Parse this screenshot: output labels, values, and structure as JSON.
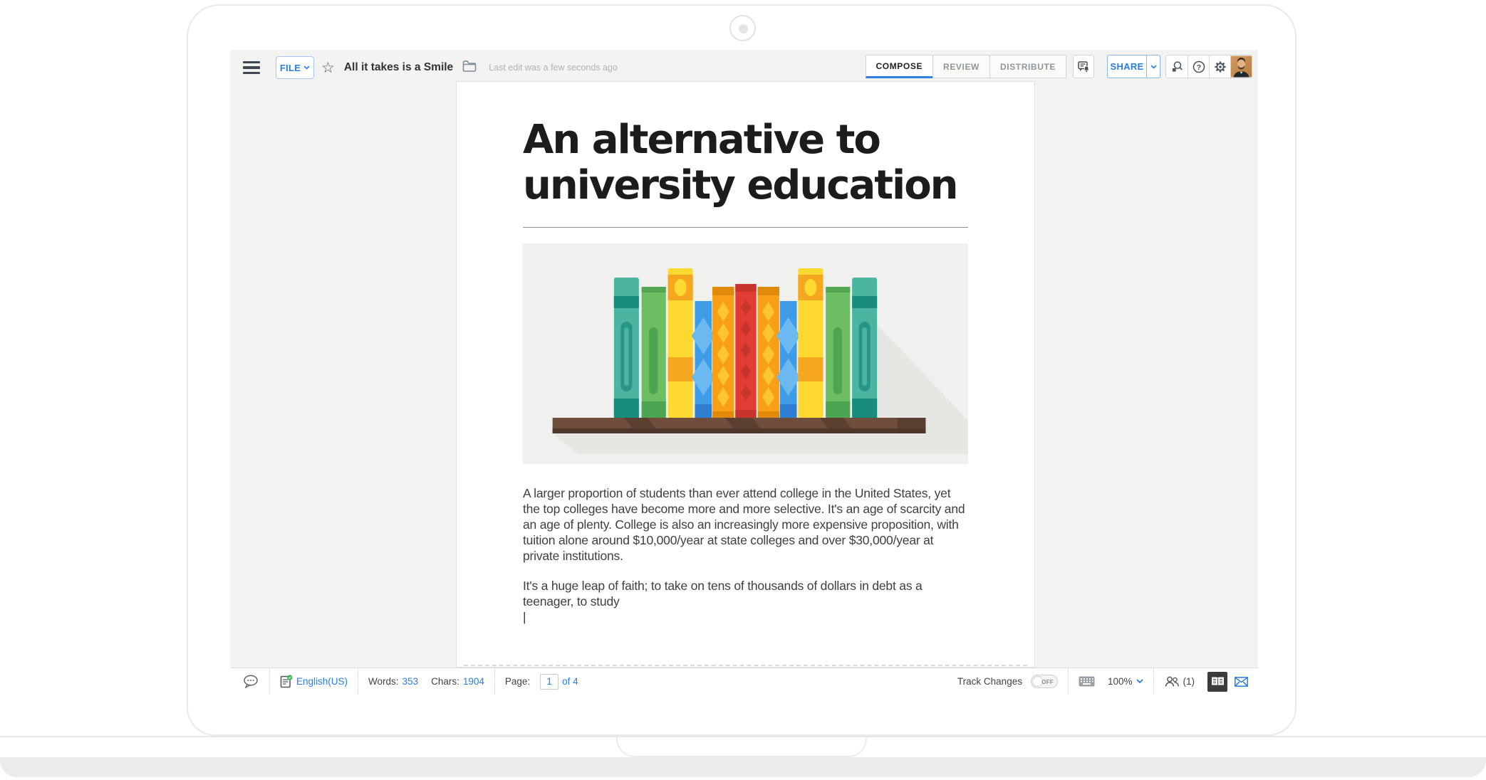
{
  "app": {
    "toolbar": {
      "file_button": "FILE",
      "doc_title": "All it takes is a Smile",
      "last_edit": "Last edit was a few seconds ago",
      "tabs": [
        {
          "label": "COMPOSE",
          "active": true
        },
        {
          "label": "REVIEW",
          "active": false
        },
        {
          "label": "DISTRIBUTE",
          "active": false
        }
      ],
      "share_button": "SHARE"
    },
    "document": {
      "title": "An alternative to university education",
      "paragraph_1": "A larger proportion of students than ever attend college in the United States, yet the top colleges have become more and more selective. It's an age of scarcity and an age of plenty. College is also an increasingly more expensive proposition, with tuition alone around $10,000/year at state colleges and over $30,000/year at private institutions.",
      "paragraph_2": "It's a huge leap of faith; to take on tens of thousands of dollars in debt as a teenager, to study",
      "cursor": "|",
      "illustration_alt": "Flat illustration of eleven colorful books (teal, green, yellow, blue, orange and red) standing on a brown wooden shelf, casting a long diagonal shadow"
    },
    "status_bar": {
      "language": "English(US)",
      "words_label": "Words:",
      "words_value": "353",
      "chars_label": "Chars:",
      "chars_value": "1904",
      "page_label": "Page:",
      "page_current": "1",
      "page_total": "of 4",
      "track_changes_label": "Track Changes",
      "track_changes_state": "OFF",
      "zoom": "100%",
      "collaborators": "(1)"
    },
    "icons": {
      "menu": "hamburger-menu",
      "favorite": "star-outline",
      "folder": "folder",
      "notifications": "comment-bell",
      "search": "magnifier-document",
      "help": "question-circle",
      "settings": "gear",
      "avatar": "user-photo",
      "comments": "speech-bubble",
      "language": "spellcheck-page-green-check",
      "keyboard": "keyboard",
      "collaborators": "two-people",
      "page_view": "open-book",
      "feedback": "envelope"
    },
    "colors": {
      "accent_blue": "#2a7de1",
      "tab_underline": "#2f80e0",
      "canvas": "#f3f3f2",
      "page": "#ffffff",
      "status_green": "#35b34a",
      "illustration_bg": "#f0f0ee",
      "illustration_shadow": "#e6e6e3",
      "shelf_brown": "#6f4e3c",
      "book_teal": "#4cb5a2",
      "book_green": "#6dbd63",
      "book_yellow": "#ffd930",
      "book_blue": "#3f9ce9",
      "book_orange": "#f89f16",
      "book_red": "#e23c34"
    }
  }
}
